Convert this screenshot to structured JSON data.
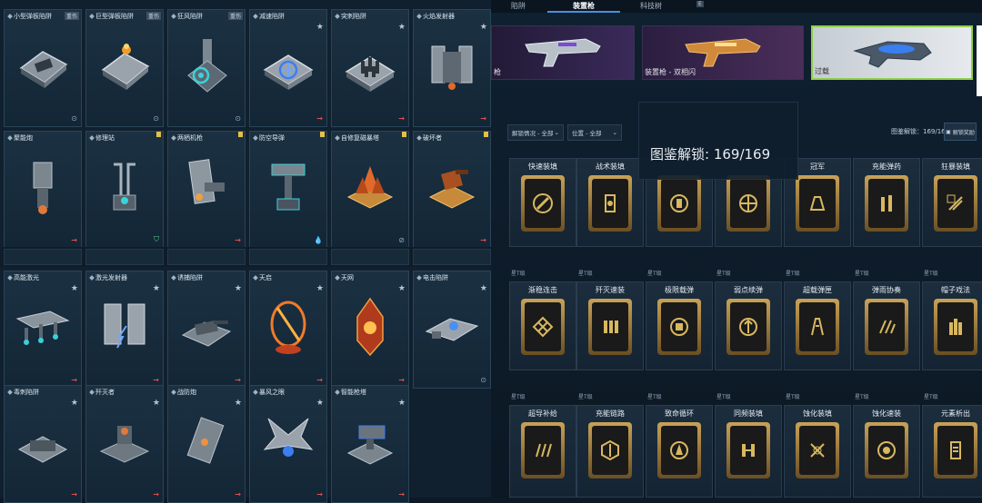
{
  "left_panel": {
    "row1": [
      {
        "name": "小型弹板陷阱",
        "tag": "重伤",
        "star": false,
        "foot": "clock"
      },
      {
        "name": "巨型弹板陷阱",
        "tag": "重伤",
        "star": false,
        "foot": "clock"
      },
      {
        "name": "狂风陷阱",
        "tag": "重伤",
        "star": false,
        "foot": "clock"
      },
      {
        "name": "减速陷阱",
        "tag": "",
        "star": true,
        "foot": "arrow"
      },
      {
        "name": "突刺陷阱",
        "tag": "",
        "star": true,
        "foot": "arrow"
      },
      {
        "name": "火焰发射器",
        "tag": "",
        "star": true,
        "foot": "arrow"
      }
    ],
    "row2": [
      {
        "name": "聚能炮",
        "flag": false,
        "foot": "arrow"
      },
      {
        "name": "修理站",
        "flag": true,
        "foot": "shield"
      },
      {
        "name": "两栖机枪",
        "flag": true,
        "foot": "arrow"
      },
      {
        "name": "防空导弹",
        "flag": true,
        "foot": "drop"
      },
      {
        "name": "自修复磁暴塔",
        "flag": true,
        "foot": "slash"
      },
      {
        "name": "破坏者",
        "flag": true,
        "foot": "arrow"
      }
    ],
    "row3": [
      {
        "name": "高能激光",
        "star": true,
        "foot": "arrow"
      },
      {
        "name": "激光发射器",
        "star": true,
        "foot": "arrow"
      },
      {
        "name": "诱捕陷阱",
        "star": true,
        "foot": "arrow"
      },
      {
        "name": "天启",
        "star": true,
        "foot": "arrow"
      },
      {
        "name": "天网",
        "star": true,
        "foot": "arrow"
      },
      {
        "name": "电击陷阱",
        "star": true,
        "foot": "clock"
      }
    ],
    "row4": [
      {
        "name": "毒刺陷阱",
        "star": true,
        "foot": "arrow"
      },
      {
        "name": "歼灭者",
        "star": true,
        "foot": "arrow"
      },
      {
        "name": "战防炮",
        "star": true,
        "foot": "arrow"
      },
      {
        "name": "暴风之眼",
        "star": true,
        "foot": "arrow"
      },
      {
        "name": "智能枪塔",
        "star": true,
        "foot": "arrow"
      }
    ]
  },
  "right_panel": {
    "tabs": [
      "陷阱",
      "装置枪",
      "科技树"
    ],
    "active_tab": "装置枪",
    "tab_badge": "E",
    "guns": [
      {
        "label": "枪"
      },
      {
        "label": "装置枪 - 双相闪"
      },
      {
        "label": "过载"
      }
    ],
    "filters": [
      {
        "label": "解锁情况 - 全部"
      },
      {
        "label": "位置 - 全部"
      }
    ],
    "dex_label": "图鉴解锁：",
    "dex_count": "169/169",
    "reward_label": "解锁奖励",
    "popup_text": "图鉴解锁:  169/169",
    "skills_row1": [
      "快速装填",
      "战术装填",
      "",
      "",
      "冠军",
      "充能弹药",
      "狂暴装填"
    ],
    "skills_row2": [
      "渐稳连击",
      "歼灭速装",
      "极限载弹",
      "弱点续弹",
      "超载弹匣",
      "弹雨协奏",
      "帽子戏法"
    ],
    "skills_row3": [
      "超导补给",
      "充能链路",
      "致命循环",
      "同频装填",
      "蚀化装填",
      "蚀化速装",
      "元素析出"
    ],
    "level_tag": "星T级"
  },
  "colors": {
    "accent_blue": "#4a90d9",
    "gold": "#c9a257",
    "alert_red": "#e05050"
  }
}
